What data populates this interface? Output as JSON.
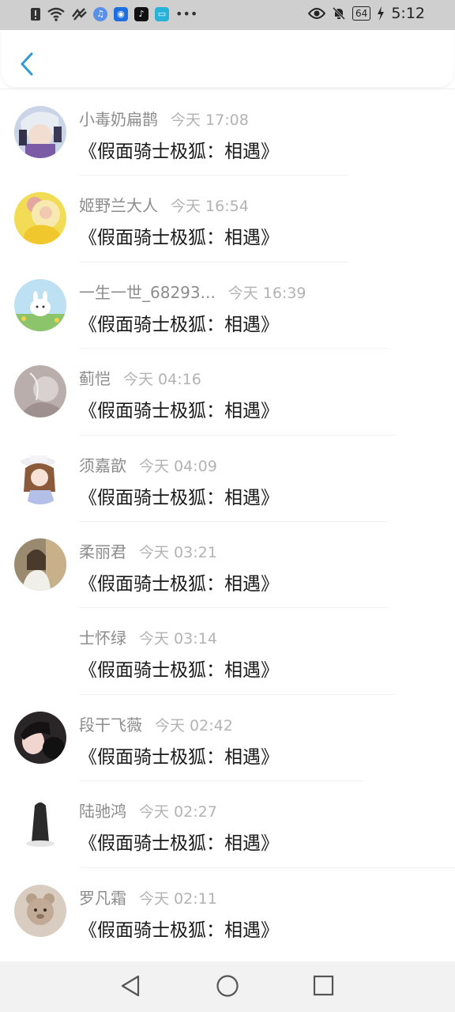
{
  "status_bar": {
    "time": "5:12",
    "battery": "64",
    "icons": [
      "alert-icon",
      "wifi-icon",
      "signal-icon",
      "music-app-icon",
      "bulb-app-icon",
      "tiktok-app-icon",
      "reader-app-icon",
      "more-dots-icon"
    ],
    "right_icons": [
      "eye-icon",
      "mute-bell-icon",
      "battery-icon",
      "charging-icon"
    ]
  },
  "header": {
    "back_icon": "chevron-left-icon",
    "accent": "#2f9bd6"
  },
  "messages": [
    {
      "name": "小毒奶扁鹊",
      "time": "今天 17:08",
      "text": "《假面骑士极狐：相遇》",
      "avatar": "anime-boy-avatar"
    },
    {
      "name": "姬野兰大人",
      "time": "今天 16:54",
      "text": "《假面骑士极狐：相遇》",
      "avatar": "princess-avatar"
    },
    {
      "name": "一生一世_68293...",
      "time": "今天 16:39",
      "text": "《假面骑士极狐：相遇》",
      "avatar": "rabbit-avatar"
    },
    {
      "name": "蓟恺",
      "time": "今天 04:16",
      "text": "《假面骑士极狐：相遇》",
      "avatar": "gray-photo-avatar"
    },
    {
      "name": "须嘉歆",
      "time": "今天 04:09",
      "text": "《假面骑士极狐：相遇》",
      "avatar": "anime-girl-hat-avatar"
    },
    {
      "name": "柔丽君",
      "time": "今天 03:21",
      "text": "《假面骑士极狐：相遇》",
      "avatar": "girl-photo-avatar"
    },
    {
      "name": "士怀绿",
      "time": "今天 03:14",
      "text": "《假面骑士极狐：相遇》",
      "avatar": "blank-avatar"
    },
    {
      "name": "段干飞薇",
      "time": "今天 02:42",
      "text": "《假面骑士极狐：相遇》",
      "avatar": "dark-portrait-avatar"
    },
    {
      "name": "陆驰鸿",
      "time": "今天 02:27",
      "text": "《假面骑士极狐：相遇》",
      "avatar": "silhouette-avatar"
    },
    {
      "name": "罗凡霜",
      "time": "今天 02:11",
      "text": "《假面骑士极狐：相遇》",
      "avatar": "teddy-bear-avatar"
    }
  ],
  "nav": {
    "back": "nav-back-icon",
    "home": "nav-home-icon",
    "recents": "nav-recents-icon"
  }
}
